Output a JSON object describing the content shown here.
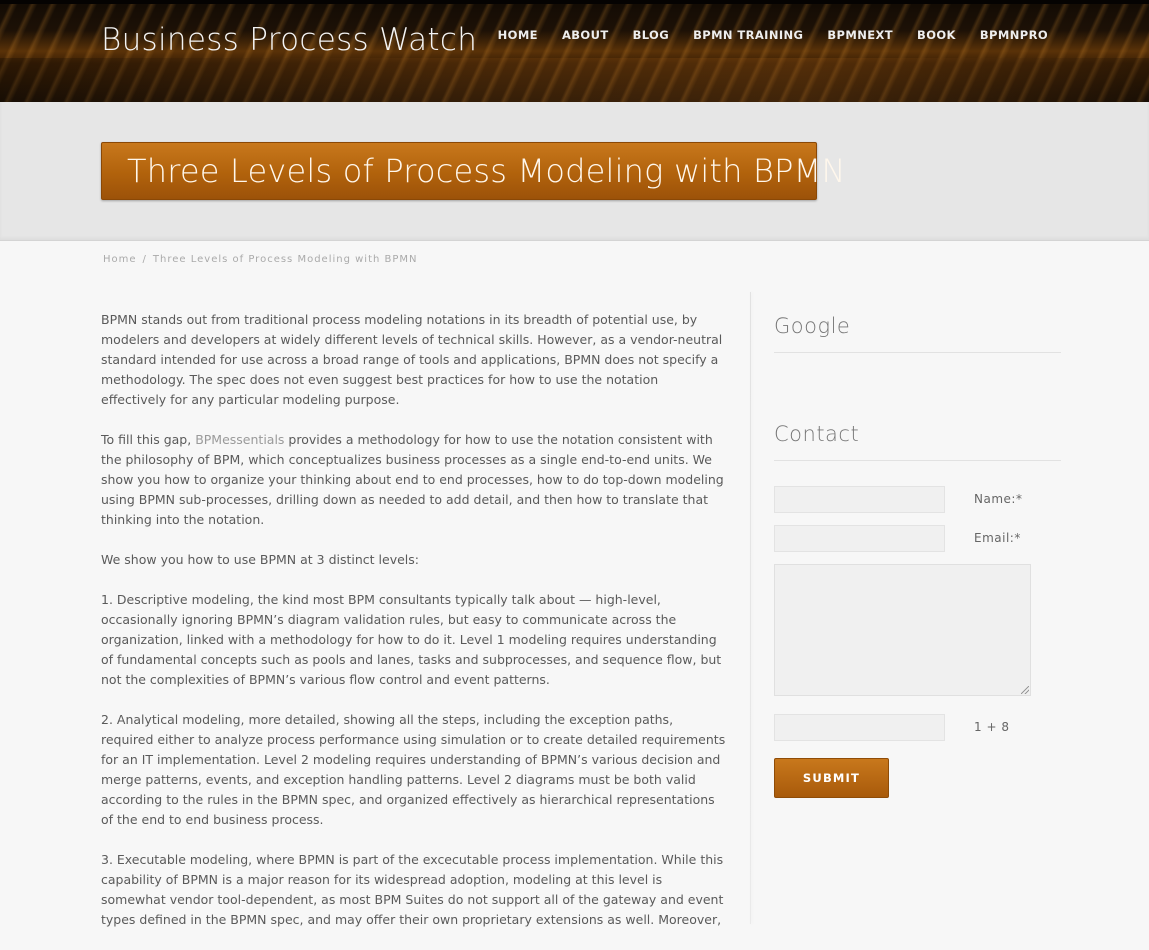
{
  "header": {
    "site_title": "Business Process Watch",
    "nav": [
      "HOME",
      "ABOUT",
      "BLOG",
      "BPMN TRAINING",
      "BPMNEXT",
      "BOOK",
      "BPMNPRO"
    ]
  },
  "page": {
    "title": "Three Levels of Process Modeling with BPMN"
  },
  "breadcrumb": {
    "home": "Home",
    "separator": "/",
    "current": "Three Levels of Process Modeling with BPMN"
  },
  "article": {
    "p1": "BPMN stands out from traditional process modeling notations in its breadth of potential use, by modelers and developers at widely different levels of technical skills.  However, as a vendor-neutral standard intended for use across a broad range of tools and applications, BPMN does not specify a methodology.  The spec does not even suggest best practices for how to use the notation effectively for any particular modeling purpose.",
    "p2_before": "To fill this gap, ",
    "p2_link": "BPMessentials",
    "p2_after": " provides a methodology for how to use the notation consistent with the philosophy of BPM, which conceptualizes business processes as a single end-to-end units.  We show you how to organize your thinking about end to end processes, how to do top-down modeling using BPMN sub-processes, drilling down as needed to add detail, and then how to translate that thinking into the notation.",
    "p3": "We show you how to use BPMN at 3 distinct levels:",
    "p4": "1.    Descriptive modeling, the kind most BPM consultants typically talk about — high-level, occasionally ignoring BPMN’s diagram validation rules, but easy to communicate across the organization, linked with a methodology for how to do it. Level 1 modeling requires understanding of fundamental concepts such as pools and lanes, tasks and subprocesses, and sequence flow, but not the complexities of BPMN’s various flow control and event patterns.",
    "p5": "2.    Analytical modeling, more detailed, showing all the steps, including the exception paths, required either to analyze process performance using simulation or to create detailed requirements for an IT implementation.  Level 2 modeling requires understanding of BPMN’s various decision and merge patterns, events, and exception handling patterns.  Level 2 diagrams must be both valid according to the rules in the BPMN spec, and organized effectively as hierarchical representations of the end to end business process.",
    "p6": "3.    Executable modeling, where BPMN is part of the excecutable process implementation. While this capability of BPMN is a major reason for its widespread adoption, modeling at this level is somewhat vendor tool-dependent, as most BPM Suites do not support all of the gateway and event types defined in the BPMN spec, and may offer their own proprietary extensions as well.  Moreover,"
  },
  "sidebar": {
    "google_title": "Google",
    "contact_title": "Contact",
    "name_label": "Name:*",
    "email_label": "Email:*",
    "captcha_label": "1 + 8",
    "submit_label": "SUBMIT"
  }
}
